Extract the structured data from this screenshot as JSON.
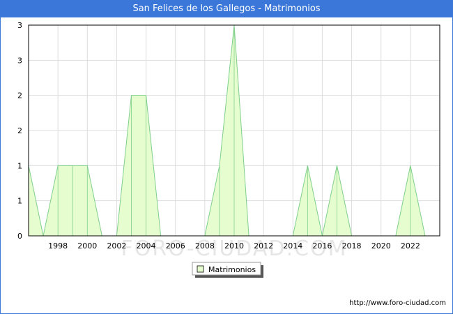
{
  "window": {
    "title": "San Felices de los Gallegos - Matrimonios"
  },
  "chart_data": {
    "type": "area",
    "title": "San Felices de los Gallegos - Matrimonios",
    "x": [
      1996,
      1997,
      1998,
      1999,
      2000,
      2001,
      2002,
      2003,
      2004,
      2005,
      2006,
      2007,
      2008,
      2009,
      2010,
      2011,
      2012,
      2013,
      2014,
      2015,
      2016,
      2017,
      2018,
      2019,
      2020,
      2021,
      2022,
      2023
    ],
    "series": [
      {
        "name": "Matrimonios",
        "values": [
          1,
          0,
          1,
          1,
          1,
          0,
          0,
          2,
          2,
          0,
          0,
          0,
          0,
          1,
          3,
          0,
          0,
          0,
          0,
          1,
          0,
          1,
          0,
          0,
          0,
          0,
          1,
          0
        ]
      }
    ],
    "x_ticks": [
      "1998",
      "2000",
      "2002",
      "2004",
      "2006",
      "2008",
      "2010",
      "2012",
      "2014",
      "2016",
      "2018",
      "2020",
      "2022"
    ],
    "y_ticks": [
      "0",
      "1",
      "1",
      "2",
      "2",
      "3",
      "3"
    ],
    "xlim": [
      1996,
      2024
    ],
    "ylim": [
      0,
      3
    ],
    "grid": true,
    "legend_position": "bottom-center",
    "colors": {
      "fill": "#e6fecf",
      "stroke": "#7fcf8a",
      "title_bar": "#3a77d9"
    }
  },
  "watermark": "FORO-CIUDAD.COM",
  "source": "http://www.foro-ciudad.com"
}
